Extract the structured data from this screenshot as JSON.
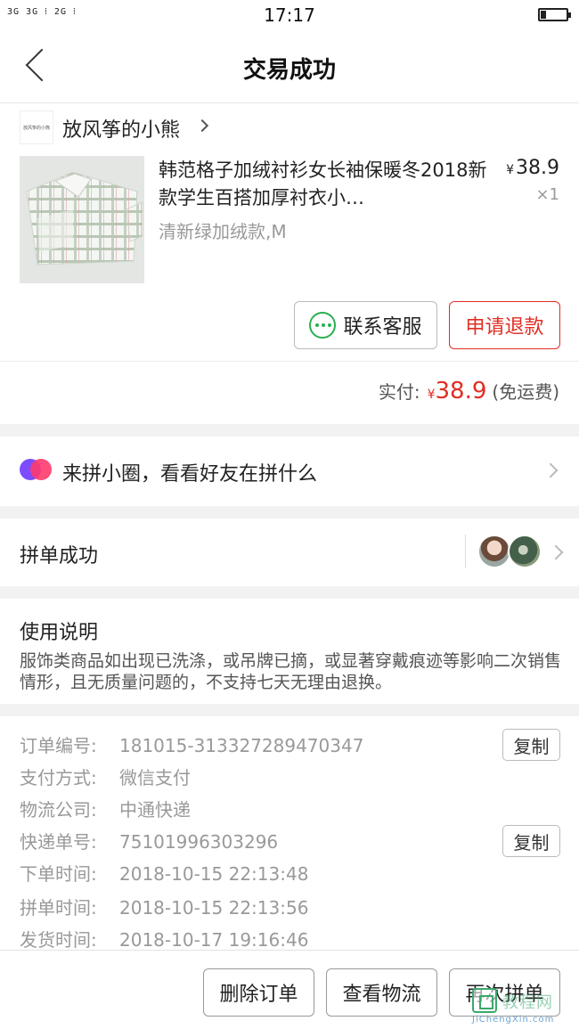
{
  "status_bar": {
    "signal": "3G 3G ⁞ 2G ⁞",
    "time": "17:17",
    "battery_level": 0.2
  },
  "header": {
    "title": "交易成功"
  },
  "shop": {
    "logo_text": "放风筝的小熊",
    "name": "放风筝的小熊"
  },
  "product": {
    "title": "韩范格子加绒衬衫女长袖保暖冬2018新款学生百搭加厚衬衣小…",
    "spec": "清新绿加绒款,M",
    "price": "38.9",
    "currency": "¥",
    "quantity": "×1"
  },
  "actions": {
    "contact_label": "联系客服",
    "refund_label": "申请退款"
  },
  "payment": {
    "label": "实付:",
    "currency": "¥",
    "amount": "38.9",
    "note": "(免运费)"
  },
  "circle": {
    "text": "来拼小圈，看看好友在拼什么"
  },
  "group": {
    "text": "拼单成功"
  },
  "usage": {
    "title": "使用说明",
    "text": "服饰类商品如出现已洗涤，或吊牌已摘，或显著穿戴痕迹等影响二次销售情形，且无质量问题的，不支持七天无理由退换。"
  },
  "order_info": {
    "copy_label": "复制",
    "rows": [
      {
        "label": "订单编号:",
        "value": "181015-313327289470347"
      },
      {
        "label": "支付方式:",
        "value": "微信支付"
      },
      {
        "label": "物流公司:",
        "value": "中通快递"
      },
      {
        "label": "快递单号:",
        "value": "75101996303296"
      },
      {
        "label": "下单时间:",
        "value": "2018-10-15 22:13:48"
      },
      {
        "label": "拼单时间:",
        "value": "2018-10-15 22:13:56"
      },
      {
        "label": "发货时间:",
        "value": "2018-10-17 19:16:46"
      }
    ]
  },
  "bottom_bar": {
    "delete_label": "删除订单",
    "logistics_label": "查看物流",
    "reorder_label": "再次拼单"
  },
  "watermark": {
    "text": "教程网",
    "sub": "JiChengXin.com"
  },
  "colors": {
    "accent_red": "#e02e24",
    "wechat_green": "#2ab04f",
    "gap_gray": "#f2f2f2"
  }
}
